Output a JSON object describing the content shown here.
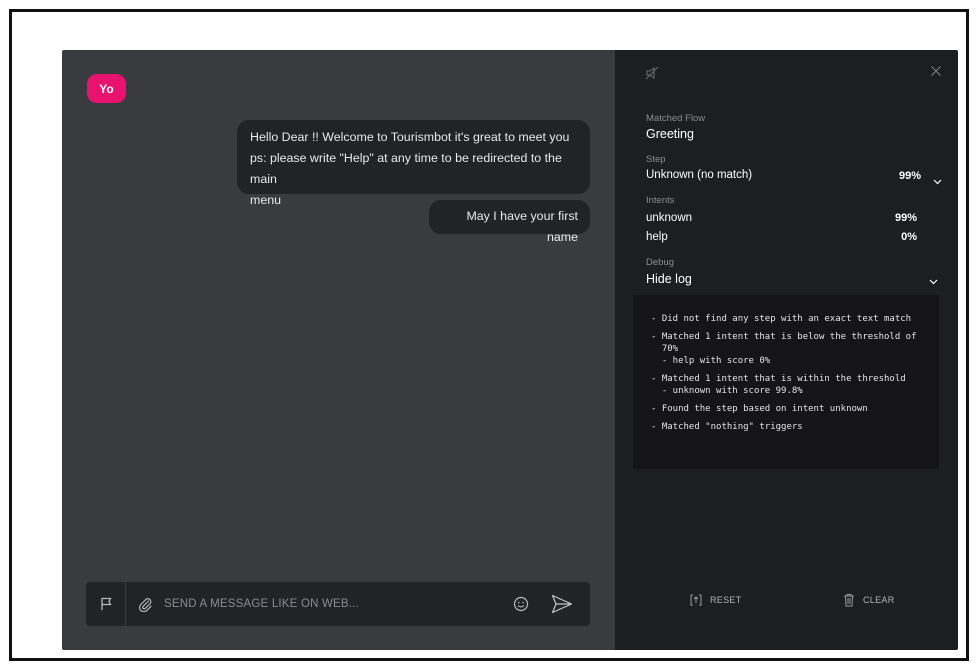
{
  "chat": {
    "avatar_text": "Yo",
    "messages": [
      {
        "lines": [
          "Hello Dear !! Welcome to Tourismbot it's great to meet you",
          "ps: please write \"Help\" at any time to be redirected to the main",
          "menu"
        ]
      },
      {
        "lines": [
          "May I have your first name"
        ]
      }
    ],
    "composer": {
      "placeholder": "SEND A MESSAGE LIKE ON WEB..."
    }
  },
  "panel": {
    "matched_flow_label": "Matched Flow",
    "matched_flow_value": "Greeting",
    "step_label": "Step",
    "step_value": "Unknown (no match)",
    "step_percent": "99%",
    "intents_label": "Intents",
    "intents": [
      {
        "name": "unknown",
        "percent": "99%"
      },
      {
        "name": "help",
        "percent": "0%"
      }
    ],
    "debug_label": "Debug",
    "debug_value": "Hide log",
    "log_lines": [
      "- Did not find any step with an exact text match",
      "- Matched 1 intent that is below the threshold of",
      "  70%",
      "  - help with score 0%",
      "- Matched 1 intent that is within the threshold",
      "  - unknown with score 99.8%",
      "- Found the step based on intent unknown",
      "- Matched \"nothing\" triggers"
    ],
    "reset_label": "RESET",
    "clear_label": "CLEAR"
  },
  "colors": {
    "accent": "#e8136f",
    "chat_bg": "#3a3b3f",
    "bubble_bg": "#222326",
    "panel_bg": "#1d1e20",
    "log_bg": "#151517"
  }
}
